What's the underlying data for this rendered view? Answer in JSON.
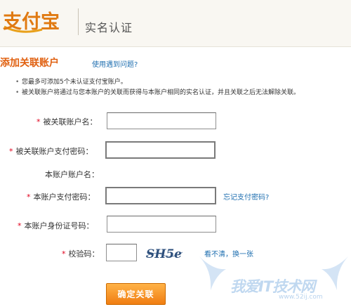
{
  "header": {
    "logo_text": "支付宝",
    "title": "实名认证"
  },
  "section": {
    "title": "添加关联账户",
    "help_link": "使用遇到问题?"
  },
  "tips": [
    "您最多可添加5个未认证支付宝账户。",
    "被关联账户将通过与您本账户的关联而获得与本账户相同的实名认证，并且关联之后无法解除关联。"
  ],
  "form": {
    "required_mark": "*",
    "linked_account_label": "被关联账户名：",
    "linked_account_value": "",
    "linked_password_label": "被关联账户支付密码：",
    "linked_password_value": "",
    "this_account_label": "本账户账户名：",
    "this_account_value": "",
    "this_password_label": "本账户支付密码：",
    "this_password_value": "",
    "forgot_password_link": "忘记支付密码?",
    "id_number_label": "本账户身份证号码：",
    "id_number_value": "",
    "captcha_label": "校验码：",
    "captcha_value": "",
    "captcha_text": "SH5e",
    "refresh_captcha_link": "看不清，换一张",
    "submit_label": "确定关联"
  },
  "watermark": {
    "text": "我爱IT技术网",
    "url": "www.52ij.com"
  },
  "colors": {
    "accent_orange": "#e06010",
    "link_blue": "#1f6fb0",
    "required_red": "#e0001b",
    "header_bg": "#f9f7f2"
  }
}
